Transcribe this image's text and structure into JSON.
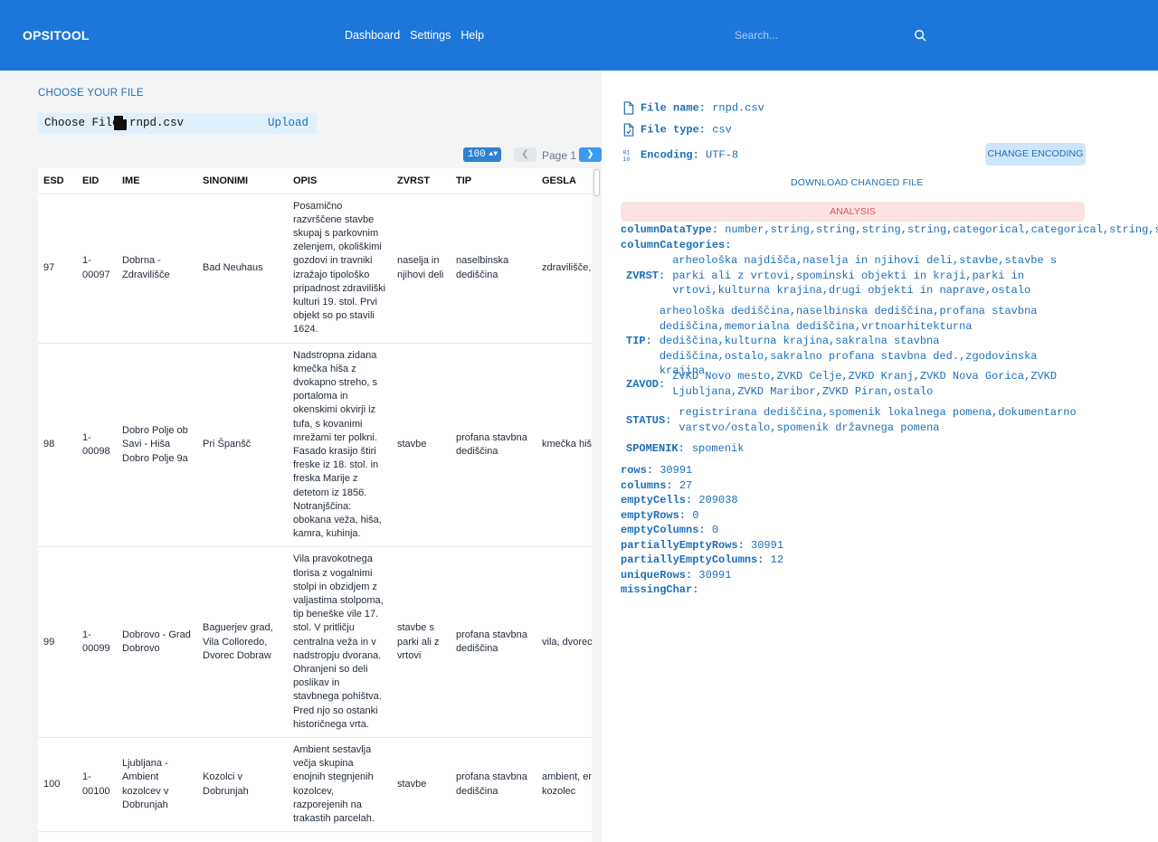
{
  "app": {
    "brand": "OPSITOOL"
  },
  "nav": {
    "dashboard": "Dashboard",
    "settings": "Settings",
    "help": "Help"
  },
  "search": {
    "placeholder": "Search..."
  },
  "upload": {
    "section_label": "CHOOSE YOUR FILE",
    "choose_button": "Choose File",
    "file_name": "rnpd.csv",
    "upload_button": "Upload"
  },
  "pagination": {
    "rows_per_page": "100",
    "page_label": "Page 1",
    "prev": "❮",
    "next": "❯"
  },
  "table": {
    "headers": [
      "ESD",
      "EID",
      "IME",
      "SINONIMI",
      "OPIS",
      "ZVRST",
      "TIP",
      "GESLA"
    ],
    "rows": [
      [
        "97",
        "1-00097",
        "Dobrna - Zdravilišče",
        "Bad Neuhaus",
        "Posamično razvrščene stavbe skupaj s parkovnim zelenjem, okoliškimi gozdovi in travniki izražajo tipološko pripadnost zdraviliški kulturi 19. stol. Prvi objekt so po stavili 1624.",
        "naselja in njihovi deli",
        "naselbinska dediščina",
        "zdravilišče, park"
      ],
      [
        "98",
        "1-00098",
        "Dobro Polje ob Savi - Hiša Dobro Polje 9a",
        "Pri Španšč",
        "Nadstropna zidana kmečka hiša z dvokapno streho, s portaloma in okenskimi okvirji iz tufa, s kovanimi mrežami ter polkni. Fasado krasijo štiri freske iz 18. stol. in freska Marije z detetom iz 1856. Notranjščina: obokana veža, hiša, kamra, kuhinja.",
        "stavbe",
        "profana stavbna dediščina",
        "kmečka hiš freska"
      ],
      [
        "99",
        "1-00099",
        "Dobrovo - Grad Dobrovo",
        "Baguerjev grad, Vila Colloredo, Dvorec Dobraw",
        "Vila pravokotnega tlorisa z vogalnimi stolpi in obzidjem z valjastima stolpoma, tip beneške vile 17. stol. V pritličju centralna veža in v nadstropju dvorana. Ohranjeni so deli poslikav in stavbnega pohištva. Pred njo so ostanki historičnega vrta.",
        "stavbe s parki ali z vrtovi",
        "profana stavbna dediščina",
        "vila, dvorec vrtom"
      ],
      [
        "100",
        "1-00100",
        "Ljubljana - Ambient kozolcev v Dobrunjah",
        "Kozolci v Dobrunjah",
        "Ambient sestavlja večja skupina enojnih stegnjenih kozolcev, razporejenih na trakastih parcelah.",
        "stavbe",
        "profana stavbna dediščina",
        "ambient, en kozolec"
      ]
    ]
  },
  "file_info": {
    "name_label": "File name:",
    "name_value": "rnpd.csv",
    "type_label": "File type:",
    "type_value": "csv",
    "encoding_label": "Encoding:",
    "encoding_value": "UTF-8",
    "change_encoding": "CHANGE ENCODING",
    "download": "DOWNLOAD CHANGED FILE",
    "analysis": "ANALYSIS"
  },
  "analysis": {
    "columnDataType_label": "columnDataType:",
    "columnDataType_value": "number,string,string,string,string,categorical,categorical,string,string,s",
    "columnCategories_label": "columnCategories:",
    "categories": [
      {
        "key": "ZVRST:",
        "value": "arheološka najdišča,naselja in njihovi deli,stavbe,stavbe s parki ali z vrtovi,spominski objekti in kraji,parki in vrtovi,kulturna krajina,drugi objekti in naprave,ostalo"
      },
      {
        "key": "TIP:",
        "value": "arheološka dediščina,naselbinska dediščina,profana stavbna dediščina,memorialna dediščina,vrtnoarhitekturna dediščina,kulturna krajina,sakralna stavbna dediščina,ostalo,sakralno profana stavbna ded.,zgodovinska krajina"
      },
      {
        "key": "ZAVOD:",
        "value": "ZVKD Novo mesto,ZVKD Celje,ZVKD Kranj,ZVKD Nova Gorica,ZVKD Ljubljana,ZVKD Maribor,ZVKD Piran,ostalo"
      },
      {
        "key": "STATUS:",
        "value": "registrirana dediščina,spomenik lokalnega pomena,dokumentarno varstvo/ostalo,spomenik državnega pomena"
      },
      {
        "key": "SPOMENIK:",
        "value": "spomenik"
      }
    ],
    "stats": [
      {
        "key": "rows:",
        "value": "30991"
      },
      {
        "key": "columns:",
        "value": "27"
      },
      {
        "key": "emptyCells:",
        "value": "209038"
      },
      {
        "key": "emptyRows:",
        "value": "0"
      },
      {
        "key": "emptyColumns:",
        "value": "0"
      },
      {
        "key": "partiallyEmptyRows:",
        "value": "30991"
      },
      {
        "key": "partiallyEmptyColumns:",
        "value": "12"
      },
      {
        "key": "uniqueRows:",
        "value": "30991"
      },
      {
        "key": "missingChar:",
        "value": ""
      }
    ]
  }
}
